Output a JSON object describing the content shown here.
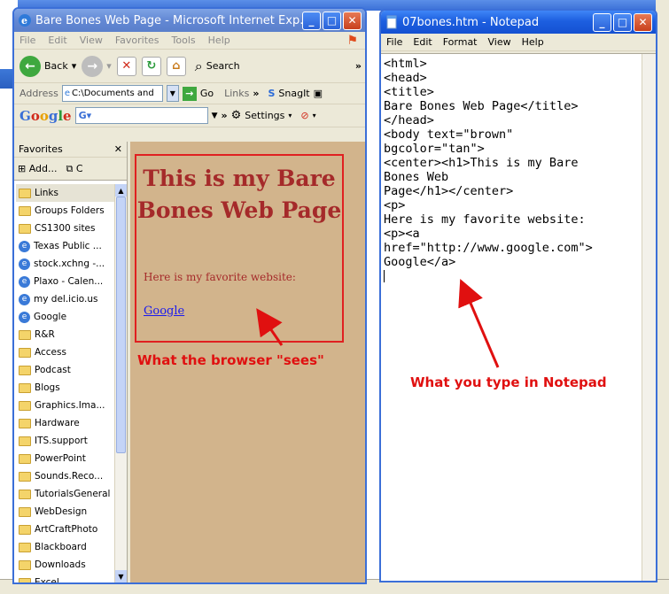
{
  "ie": {
    "title": "Bare Bones Web Page - Microsoft Internet Exp...",
    "menu": [
      "File",
      "Edit",
      "View",
      "Favorites",
      "Tools",
      "Help"
    ],
    "toolbar": {
      "back": "Back",
      "search": "Search",
      "chevrons": "»"
    },
    "address": {
      "label": "Address",
      "value": "C:\\Documents and",
      "go": "Go",
      "links": "Links",
      "snagit": "SnagIt"
    },
    "google_bar": {
      "logo": "Google",
      "settings": "Settings"
    },
    "favorites": {
      "title": "Favorites",
      "close": "✕",
      "add": "Add...",
      "organize": "C",
      "items": [
        {
          "label": "Links",
          "type": "folder"
        },
        {
          "label": "Groups Folders",
          "type": "folder"
        },
        {
          "label": "CS1300 sites",
          "type": "folder"
        },
        {
          "label": "Texas Public ...",
          "type": "link"
        },
        {
          "label": "stock.xchng -...",
          "type": "link"
        },
        {
          "label": "Plaxo - Calen...",
          "type": "link"
        },
        {
          "label": "my del.icio.us",
          "type": "link"
        },
        {
          "label": "Google",
          "type": "link"
        },
        {
          "label": "R&R",
          "type": "folder"
        },
        {
          "label": "Access",
          "type": "folder"
        },
        {
          "label": "Podcast",
          "type": "folder"
        },
        {
          "label": "Blogs",
          "type": "folder"
        },
        {
          "label": "Graphics.Ima...",
          "type": "folder"
        },
        {
          "label": "Hardware",
          "type": "folder"
        },
        {
          "label": "ITS.support",
          "type": "folder"
        },
        {
          "label": "PowerPoint",
          "type": "folder"
        },
        {
          "label": "Sounds.Reco...",
          "type": "folder"
        },
        {
          "label": "TutorialsGeneral",
          "type": "folder"
        },
        {
          "label": "WebDesign",
          "type": "folder"
        },
        {
          "label": "ArtCraftPhoto",
          "type": "folder"
        },
        {
          "label": "Blackboard",
          "type": "folder"
        },
        {
          "label": "Downloads",
          "type": "folder"
        },
        {
          "label": "Excel",
          "type": "folder"
        }
      ]
    },
    "page": {
      "heading": "This is my Bare Bones Web Page",
      "paragraph": "Here is my favorite website:",
      "link": "Google"
    }
  },
  "notepad": {
    "title": "07bones.htm - Notepad",
    "menu": [
      "File",
      "Edit",
      "Format",
      "View",
      "Help"
    ],
    "lines": [
      "<html>",
      "<head>",
      "<title>",
      "Bare Bones Web Page</title>",
      "</head>",
      "<body text=\"brown\"",
      "bgcolor=\"tan\">",
      "<center><h1>This is my Bare",
      "Bones Web",
      "Page</h1></center>",
      "<p>",
      "Here is my favorite website:",
      "<p><a",
      "href=\"http://www.google.com\">",
      "Google</a>"
    ]
  },
  "annotations": {
    "browser": "What the browser \"sees\"",
    "notepad": "What you type in Notepad"
  },
  "colors": {
    "page_text": "#a52a2a",
    "page_bg": "#d2b48c",
    "annotation": "#e01010",
    "titlebar": "#1d5fe0"
  }
}
